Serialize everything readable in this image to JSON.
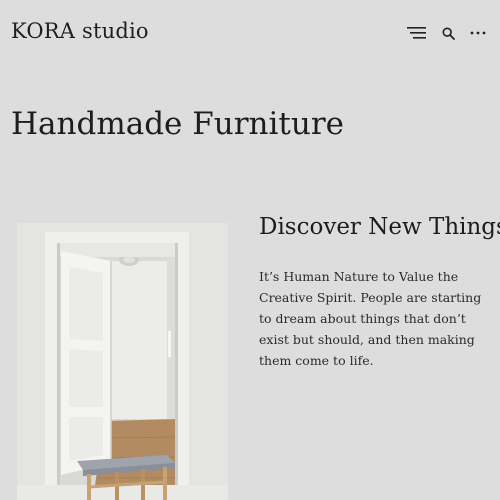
{
  "header": {
    "site_title": "KORA studio",
    "icons": [
      "menu-icon",
      "search-icon",
      "more-icon"
    ]
  },
  "main": {
    "page_title": "Handmade Furniture",
    "section": {
      "heading": "Discover New Things",
      "body": "It’s Human Nature to Value the Creative Spirit. People are starting to dream about things that don’t exist but should, and then making them come to life."
    }
  },
  "colors": {
    "background": "#dddddd",
    "text": "#1e1e1e"
  }
}
